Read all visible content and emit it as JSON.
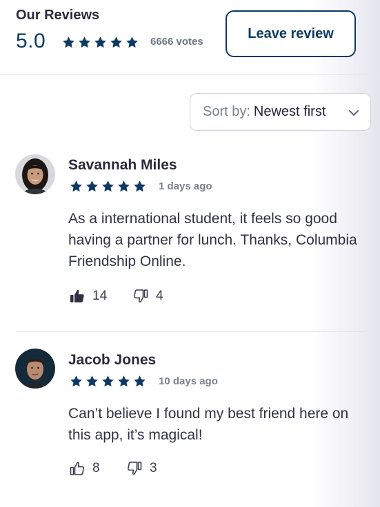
{
  "header": {
    "title": "Our Reviews",
    "score": "5.0",
    "votes": "6666 votes",
    "leave_label": "Leave review"
  },
  "sort": {
    "label": "Sort by:",
    "value": "Newest first"
  },
  "colors": {
    "accent": "#0b3963",
    "star": "#0b3963"
  },
  "reviews": [
    {
      "name": "Savannah Miles",
      "rating": 5,
      "time": "1 days ago",
      "text": "As a international student, it feels so good having a partner for lunch. Thanks, Columbia Friendship Online.",
      "likes": "14",
      "dislikes": "4",
      "liked": true
    },
    {
      "name": "Jacob Jones",
      "rating": 5,
      "time": "10 days ago",
      "text": "Can’t believe I found my best friend here on this app, it’s magical!",
      "likes": "8",
      "dislikes": "3",
      "liked": false
    }
  ]
}
